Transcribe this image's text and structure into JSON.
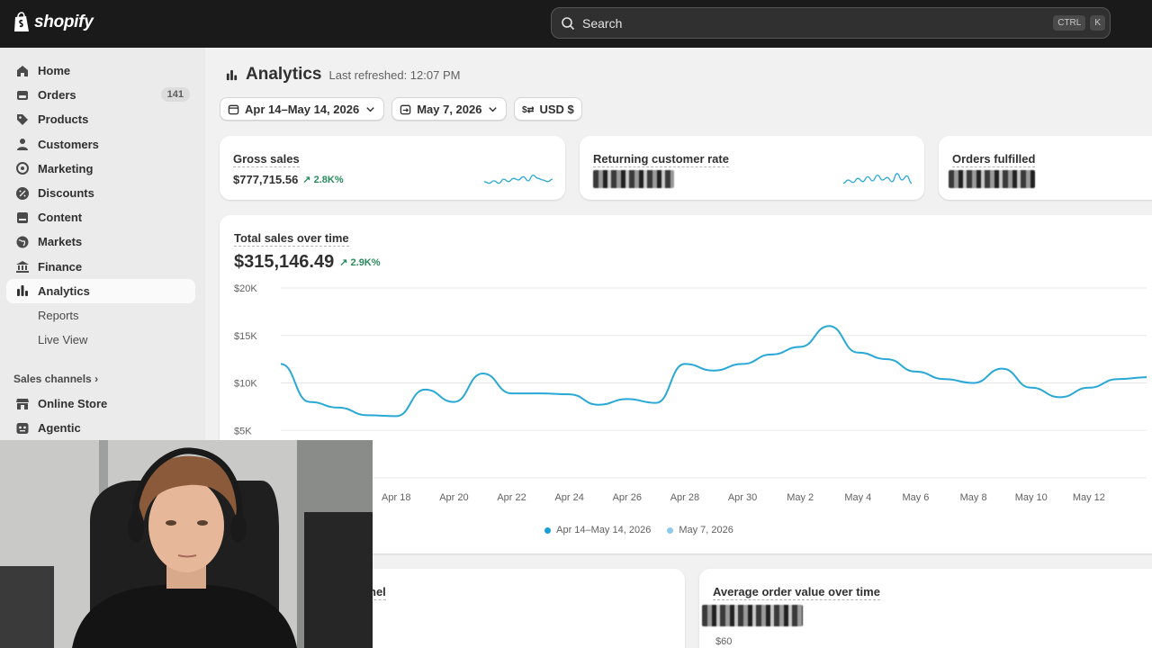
{
  "app": {
    "brand": "shopify"
  },
  "search": {
    "placeholder": "Search",
    "kbd_ctrl": "CTRL",
    "kbd_key": "K"
  },
  "sidebar": {
    "items": [
      {
        "label": "Home",
        "icon": "home-icon"
      },
      {
        "label": "Orders",
        "icon": "orders-icon",
        "badge": "141"
      },
      {
        "label": "Products",
        "icon": "tag-icon"
      },
      {
        "label": "Customers",
        "icon": "person-icon"
      },
      {
        "label": "Marketing",
        "icon": "target-icon"
      },
      {
        "label": "Discounts",
        "icon": "discount-icon"
      },
      {
        "label": "Content",
        "icon": "content-icon"
      },
      {
        "label": "Markets",
        "icon": "globe-icon"
      },
      {
        "label": "Finance",
        "icon": "bank-icon"
      },
      {
        "label": "Analytics",
        "icon": "bar-chart-icon",
        "active": true
      }
    ],
    "sub_items": [
      {
        "label": "Reports"
      },
      {
        "label": "Live View"
      }
    ],
    "sales_channels_label": "Sales channels",
    "channels": [
      {
        "label": "Online Store",
        "icon": "store-icon"
      },
      {
        "label": "Agentic",
        "icon": "agentic-icon"
      }
    ]
  },
  "page": {
    "title": "Analytics",
    "subtitle": "Last refreshed: 12:07 PM"
  },
  "filters": {
    "date_range": "Apr 14–May 14, 2026",
    "compare": "May 7, 2026",
    "currency": "USD $"
  },
  "metrics": [
    {
      "label": "Gross sales",
      "value": "$777,715.56",
      "delta": "2.8K%",
      "spark": [
        0.4,
        0.3,
        0.45,
        0.3,
        0.55,
        0.4,
        0.6,
        0.5,
        0.7,
        0.45,
        0.8,
        0.6,
        0.5,
        0.4,
        0.55
      ]
    },
    {
      "label": "Returning customer rate",
      "value": "",
      "delta": "",
      "spark": [
        0.3,
        0.5,
        0.35,
        0.6,
        0.4,
        0.7,
        0.45,
        0.8,
        0.5,
        0.65,
        0.4,
        0.9,
        0.5,
        0.75,
        0.3
      ]
    },
    {
      "label": "Orders fulfilled",
      "value": "",
      "delta": ""
    }
  ],
  "sales_chart": {
    "title": "Total sales over time",
    "total": "$315,146.49",
    "delta": "2.9K%",
    "line_color": "#29a8d6"
  },
  "chart_data": {
    "type": "line",
    "title": "Total sales over time",
    "ylim": [
      0,
      20000
    ],
    "y_ticks": [
      "$20K",
      "$15K",
      "$10K",
      "$5K"
    ],
    "y_tick_values": [
      20000,
      15000,
      10000,
      5000
    ],
    "x_tick_labels": [
      "Apr 18",
      "Apr 20",
      "Apr 22",
      "Apr 24",
      "Apr 26",
      "Apr 28",
      "Apr 30",
      "May 2",
      "May 4",
      "May 6",
      "May 8",
      "May 10",
      "May 12"
    ],
    "x_tick_days": [
      4,
      6,
      8,
      10,
      12,
      14,
      16,
      18,
      20,
      22,
      24,
      26,
      28
    ],
    "series": [
      {
        "name": "Apr 14–May 14, 2026",
        "values": [
          12000,
          8000,
          7400,
          6600,
          6500,
          9300,
          8000,
          11000,
          8900,
          8900,
          8800,
          7700,
          8300,
          7900,
          12000,
          11300,
          12000,
          13000,
          13800,
          16000,
          13200,
          12500,
          11200,
          10400,
          10000,
          11500,
          9500,
          8500,
          9500,
          10400,
          10600
        ]
      }
    ],
    "legend": [
      "Apr 14–May 14, 2026",
      "May 7, 2026"
    ],
    "legend_colors": [
      "#1aa0d8",
      "#8fcbe8"
    ]
  },
  "lower_cards": [
    {
      "title": "nel"
    },
    {
      "title": "Average order value over time",
      "tick": "$60"
    }
  ]
}
